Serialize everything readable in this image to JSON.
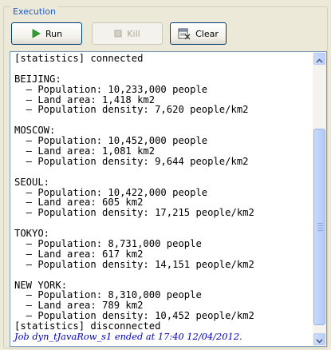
{
  "group": {
    "title": "Execution"
  },
  "toolbar": {
    "run_label": "Run",
    "kill_label": "Kill",
    "clear_label": "Clear"
  },
  "console": {
    "lines": [
      "[statistics] connected",
      "",
      "BEIJING:",
      "  – Population: 10,233,000 people",
      "  – Land area: 1,418 km2",
      "  – Population density: 7,620 people/km2",
      "",
      "MOSCOW:",
      "  – Population: 10,452,000 people",
      "  – Land area: 1,081 km2",
      "  – Population density: 9,644 people/km2",
      "",
      "SEOUL:",
      "  – Population: 10,422,000 people",
      "  – Land area: 605 km2",
      "  – Population density: 17,215 people/km2",
      "",
      "TOKYO:",
      "  – Population: 8,731,000 people",
      "  – Land area: 617 km2",
      "  – Population density: 14,151 people/km2",
      "",
      "NEW YORK:",
      "  – Population: 8,310,000 people",
      "  – Land area: 789 km2",
      "  – Population density: 10,452 people/km2",
      "[statistics] disconnected"
    ],
    "job_status": "Job dyn_tJavaRow_s1 ended at 17:40 12/04/2012."
  },
  "colors": {
    "run_icon": "#2da32d",
    "group_title": "#1d5ccf",
    "job_status": "#0000c0"
  },
  "icons": {
    "run": "play-icon",
    "kill": "stop-icon",
    "clear": "clear-console-icon"
  }
}
